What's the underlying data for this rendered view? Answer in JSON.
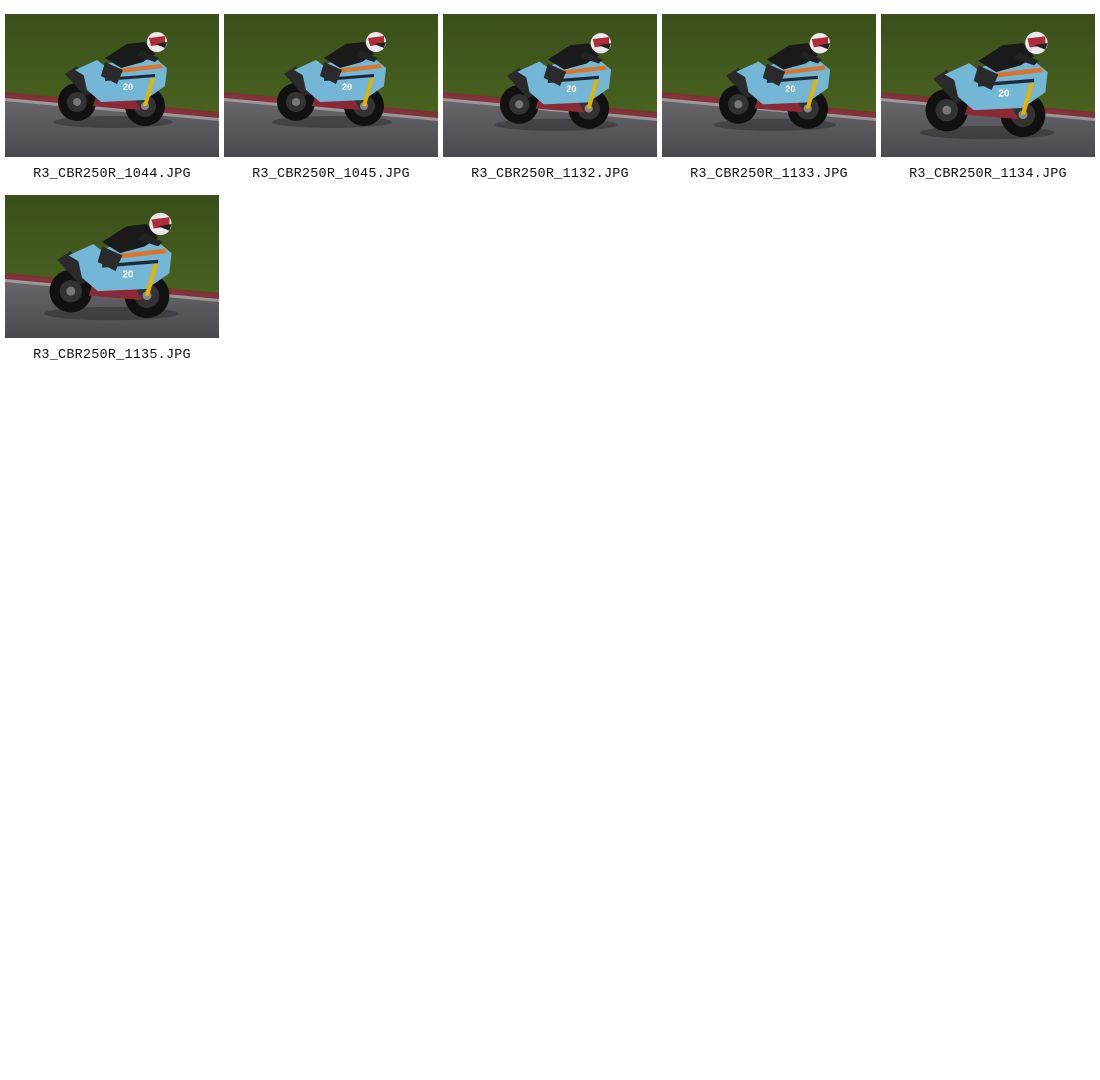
{
  "gallery": {
    "items": [
      {
        "filename": "R3_CBR250R_1044.JPG",
        "bike_number": "20",
        "variant": "a"
      },
      {
        "filename": "R3_CBR250R_1045.JPG",
        "bike_number": "20",
        "variant": "a"
      },
      {
        "filename": "R3_CBR250R_1132.JPG",
        "bike_number": "20",
        "variant": "b"
      },
      {
        "filename": "R3_CBR250R_1133.JPG",
        "bike_number": "20",
        "variant": "b"
      },
      {
        "filename": "R3_CBR250R_1134.JPG",
        "bike_number": "20",
        "variant": "c"
      },
      {
        "filename": "R3_CBR250R_1135.JPG",
        "bike_number": "20",
        "variant": "c"
      }
    ]
  },
  "colors": {
    "grass": "#4f6b22",
    "grass_dark": "#3a4f1a",
    "asphalt": "#5a5a5e",
    "kerb_red": "#8a2a36",
    "fairing_blue": "#74b6d6",
    "fairing_orange": "#d9742c",
    "caption_text": "#111111",
    "background": "#ffffff"
  }
}
